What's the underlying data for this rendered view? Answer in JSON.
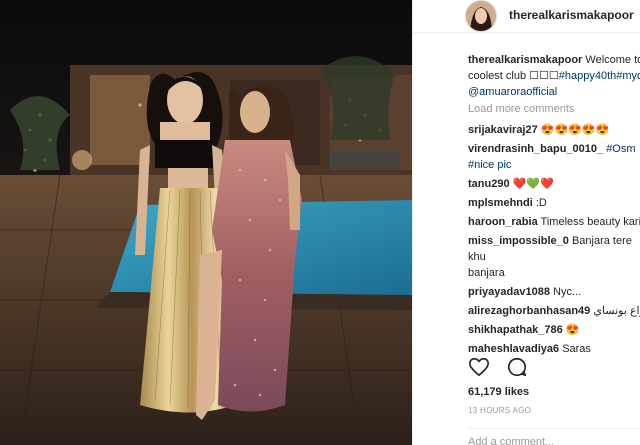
{
  "post": {
    "username": "therealkarismakapoor",
    "caption": {
      "username": "therealkarismakapoor",
      "text_1": " Welcome to",
      "text_2": "coolest club ",
      "emoji": "☐☐☐",
      "hashtag": "#happy40th",
      "hashtag_2": "#myc",
      "mention": "@amuaroraofficial"
    },
    "load_more": "Load more comments",
    "comments": [
      {
        "user": "srijakaviraj27",
        "text": "😍😍😍😍😍"
      },
      {
        "user": "virendrasinh_bapu_0010_",
        "text": "#Osm",
        "text_2": "#nice pic"
      },
      {
        "user": "tanu290",
        "text": "❤️💚❤️"
      },
      {
        "user": "mplsmehndi",
        "text": ":D"
      },
      {
        "user": "haroon_rabia",
        "text": "Timeless beauty karis"
      },
      {
        "user": "miss_impossible_0",
        "text": "Banjara tere khu",
        "text_2": "banjara"
      },
      {
        "user": "priyayadav1088",
        "text": "Nyc..."
      },
      {
        "user": "alirezaghorbanhasan49",
        "text": "انواع بونساي"
      },
      {
        "user": "shikhapathak_786",
        "text": "😍"
      },
      {
        "user": "maheshlavadiya6",
        "text": "Saras"
      }
    ],
    "likes": "61,179 likes",
    "time_ago": "13 HOURS AGO",
    "add_comment_placeholder": "Add a comment...",
    "icons": {
      "like": "heart-icon",
      "comment": "comment-bubble-icon",
      "avatar": "profile-avatar"
    }
  }
}
